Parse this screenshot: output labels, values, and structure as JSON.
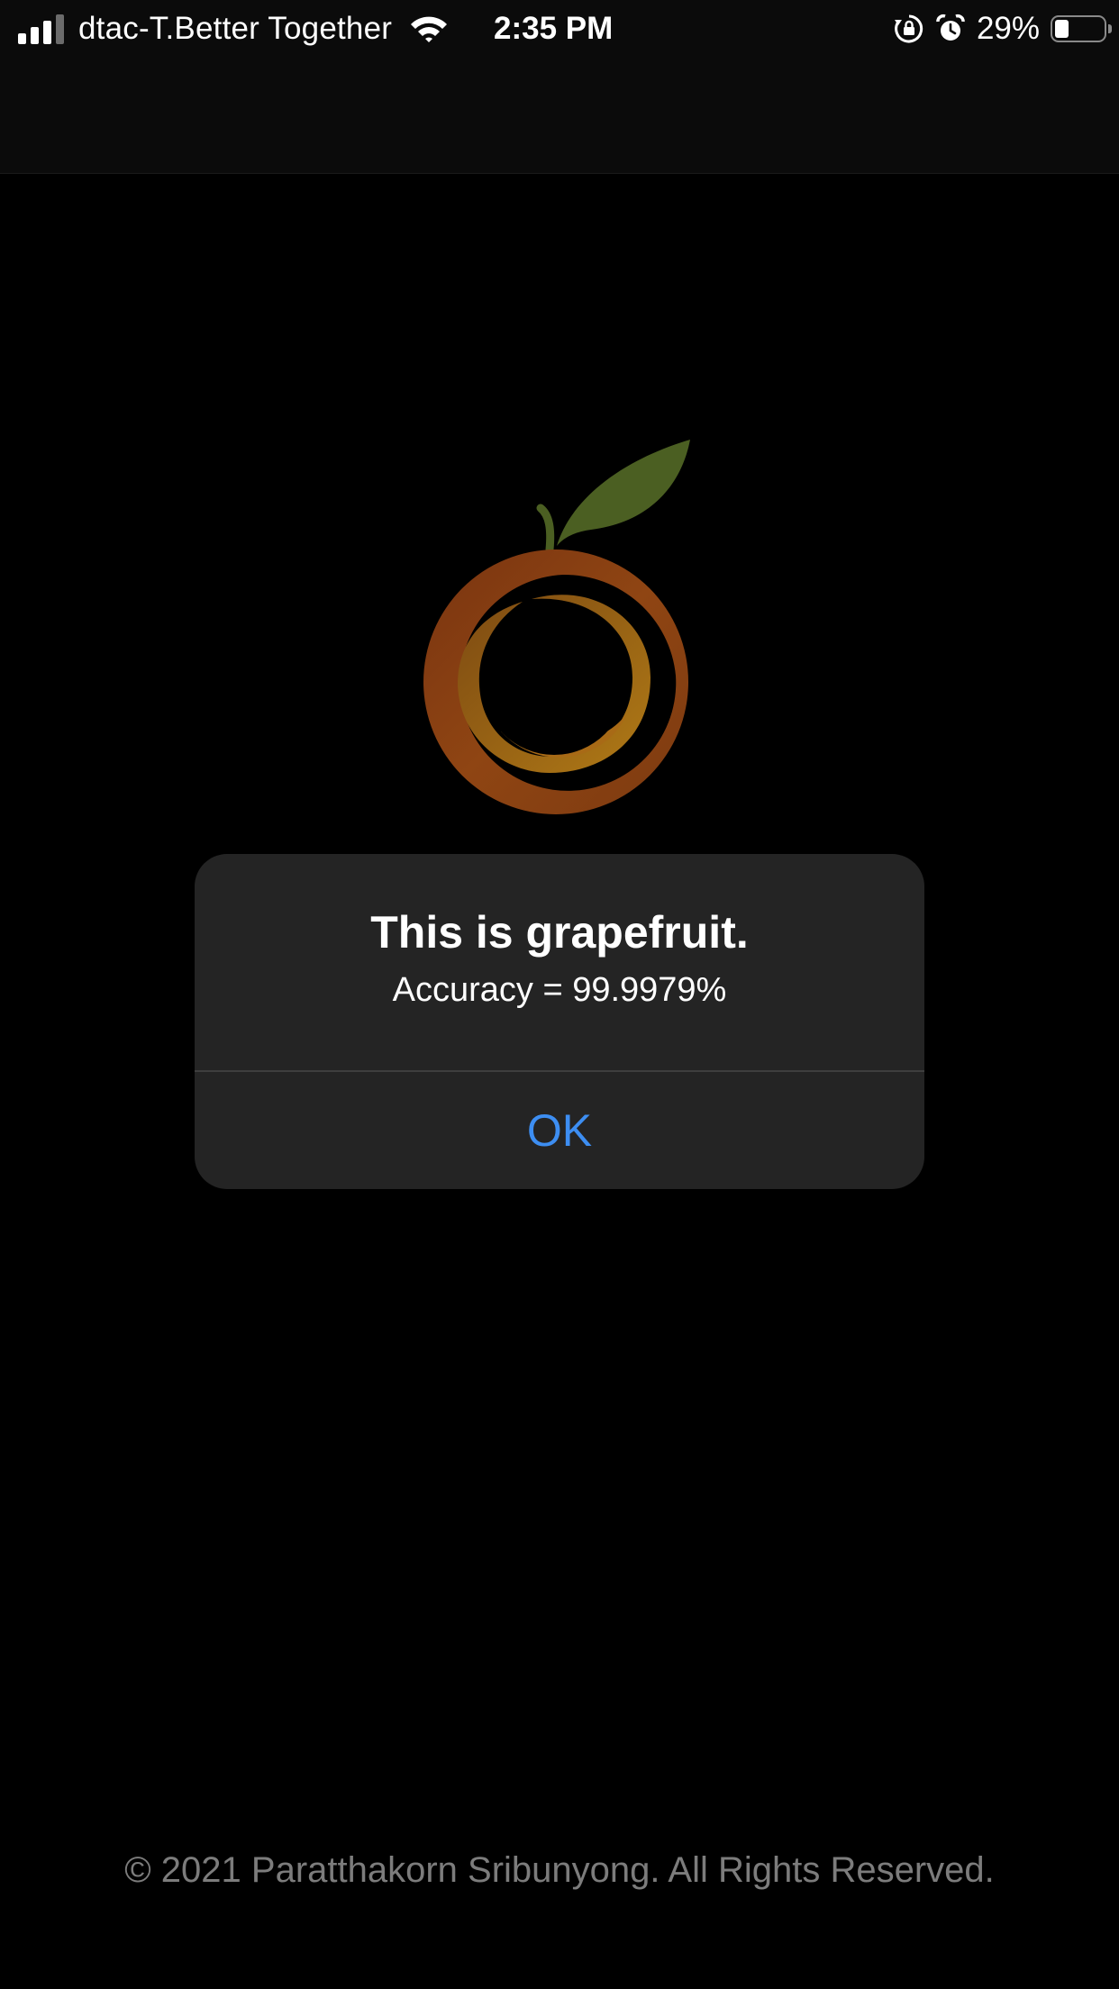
{
  "status_bar": {
    "carrier": "dtac-T.Better Together",
    "time": "2:35 PM",
    "battery_percent": "29%",
    "battery_level": 0.29,
    "signal_bars_filled": 3,
    "signal_bars_total": 4,
    "icons": [
      "signal-icon",
      "wifi-icon",
      "orientation-lock-icon",
      "alarm-icon",
      "battery-icon"
    ]
  },
  "logo": {
    "icon": "fruit-logo",
    "colors": {
      "ring_outer": "#8b3d12",
      "ring_inner": "#a66a14",
      "leaf": "#4b5f22",
      "stem": "#4b5f22"
    }
  },
  "alert": {
    "title": "This is grapefruit.",
    "message": "Accuracy = 99.9979%",
    "button_label": "OK"
  },
  "footer": {
    "copyright": "© 2021 Paratthakorn Sribunyong. All Rights Reserved."
  },
  "colors": {
    "background": "#000000",
    "alert_background": "#242424",
    "accent": "#3d8ef2",
    "footer_text": "#7c7c7c"
  }
}
